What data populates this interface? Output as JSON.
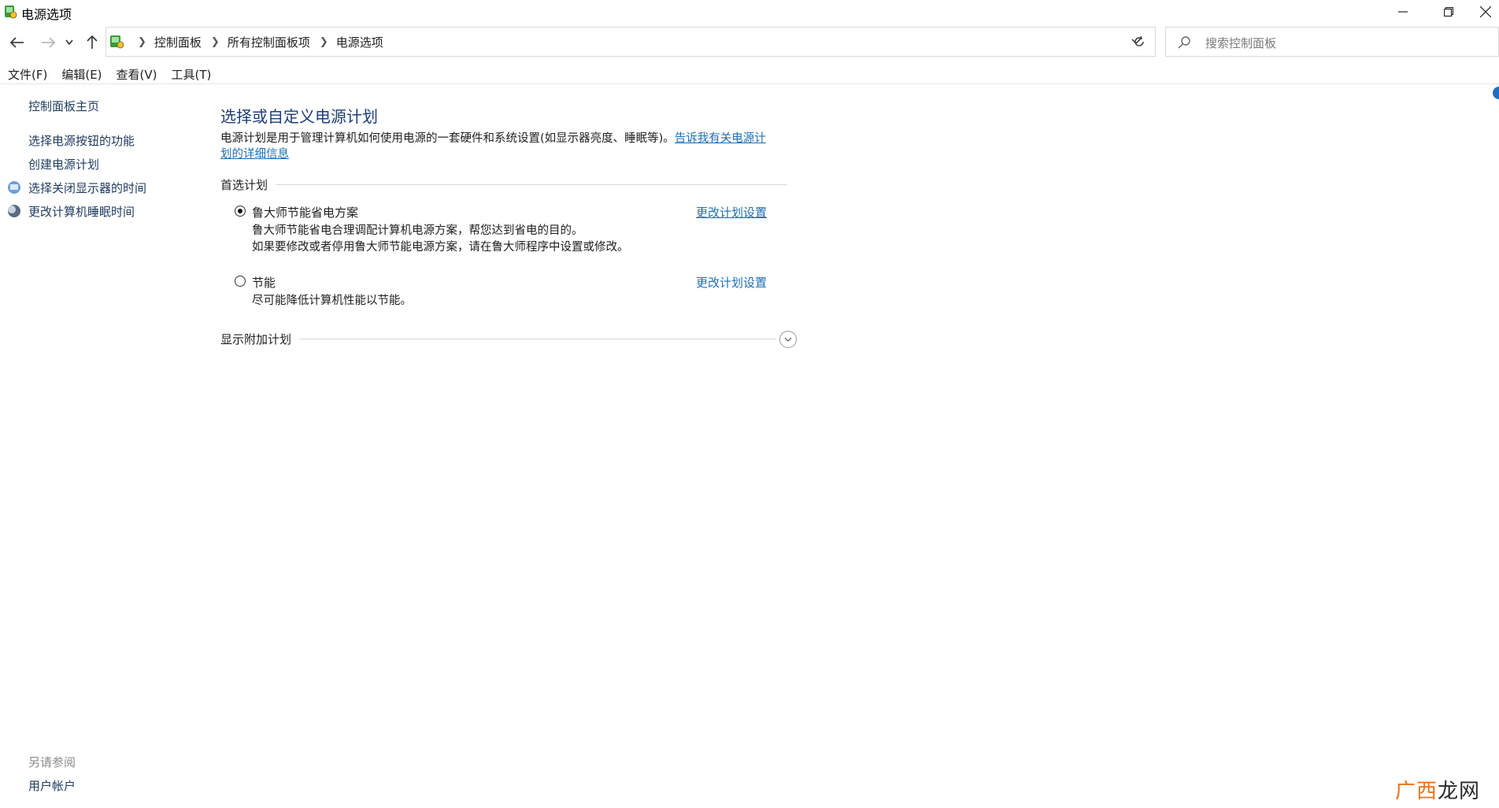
{
  "window": {
    "title": "电源选项",
    "minimize_label": "minimize",
    "restore_label": "restore",
    "close_label": "close"
  },
  "address": {
    "crumbs": [
      "控制面板",
      "所有控制面板项",
      "电源选项"
    ]
  },
  "search": {
    "placeholder": "搜索控制面板"
  },
  "menu": [
    "文件(F)",
    "编辑(E)",
    "查看(V)",
    "工具(T)"
  ],
  "sidebar": {
    "home": "控制面板主页",
    "items": [
      "选择电源按钮的功能",
      "创建电源计划",
      "选择关闭显示器的时间",
      "更改计算机睡眠时间"
    ],
    "see_also": "另请参阅",
    "user_accounts": "用户帐户"
  },
  "main": {
    "title": "选择或自定义电源计划",
    "intro_text": "电源计划是用于管理计算机如何使用电源的一套硬件和系统设置(如显示器亮度、睡眠等)。",
    "intro_link_1": "告诉我有关电源计",
    "intro_link_2": "划的详细信息",
    "preferred_header": "首选计划",
    "plans": [
      {
        "name": "鲁大师节能省电方案",
        "selected": true,
        "desc1": "鲁大师节能省电合理调配计算机电源方案，帮您达到省电的目的。",
        "desc2": "如果要修改或者停用鲁大师节能电源方案，请在鲁大师程序中设置或修改。",
        "link": "更改计划设置"
      },
      {
        "name": "节能",
        "selected": false,
        "desc1": "尽可能降低计算机性能以节能。",
        "link": "更改计划设置"
      }
    ],
    "additional_header": "显示附加计划"
  },
  "watermark": {
    "part1": "广西",
    "part2": "龙网"
  },
  "colors": {
    "title_blue": "#1e3d78",
    "link_blue": "#1e6fb5",
    "nav_link": "#1e3a5f",
    "watermark_orange": "#e8721c"
  }
}
